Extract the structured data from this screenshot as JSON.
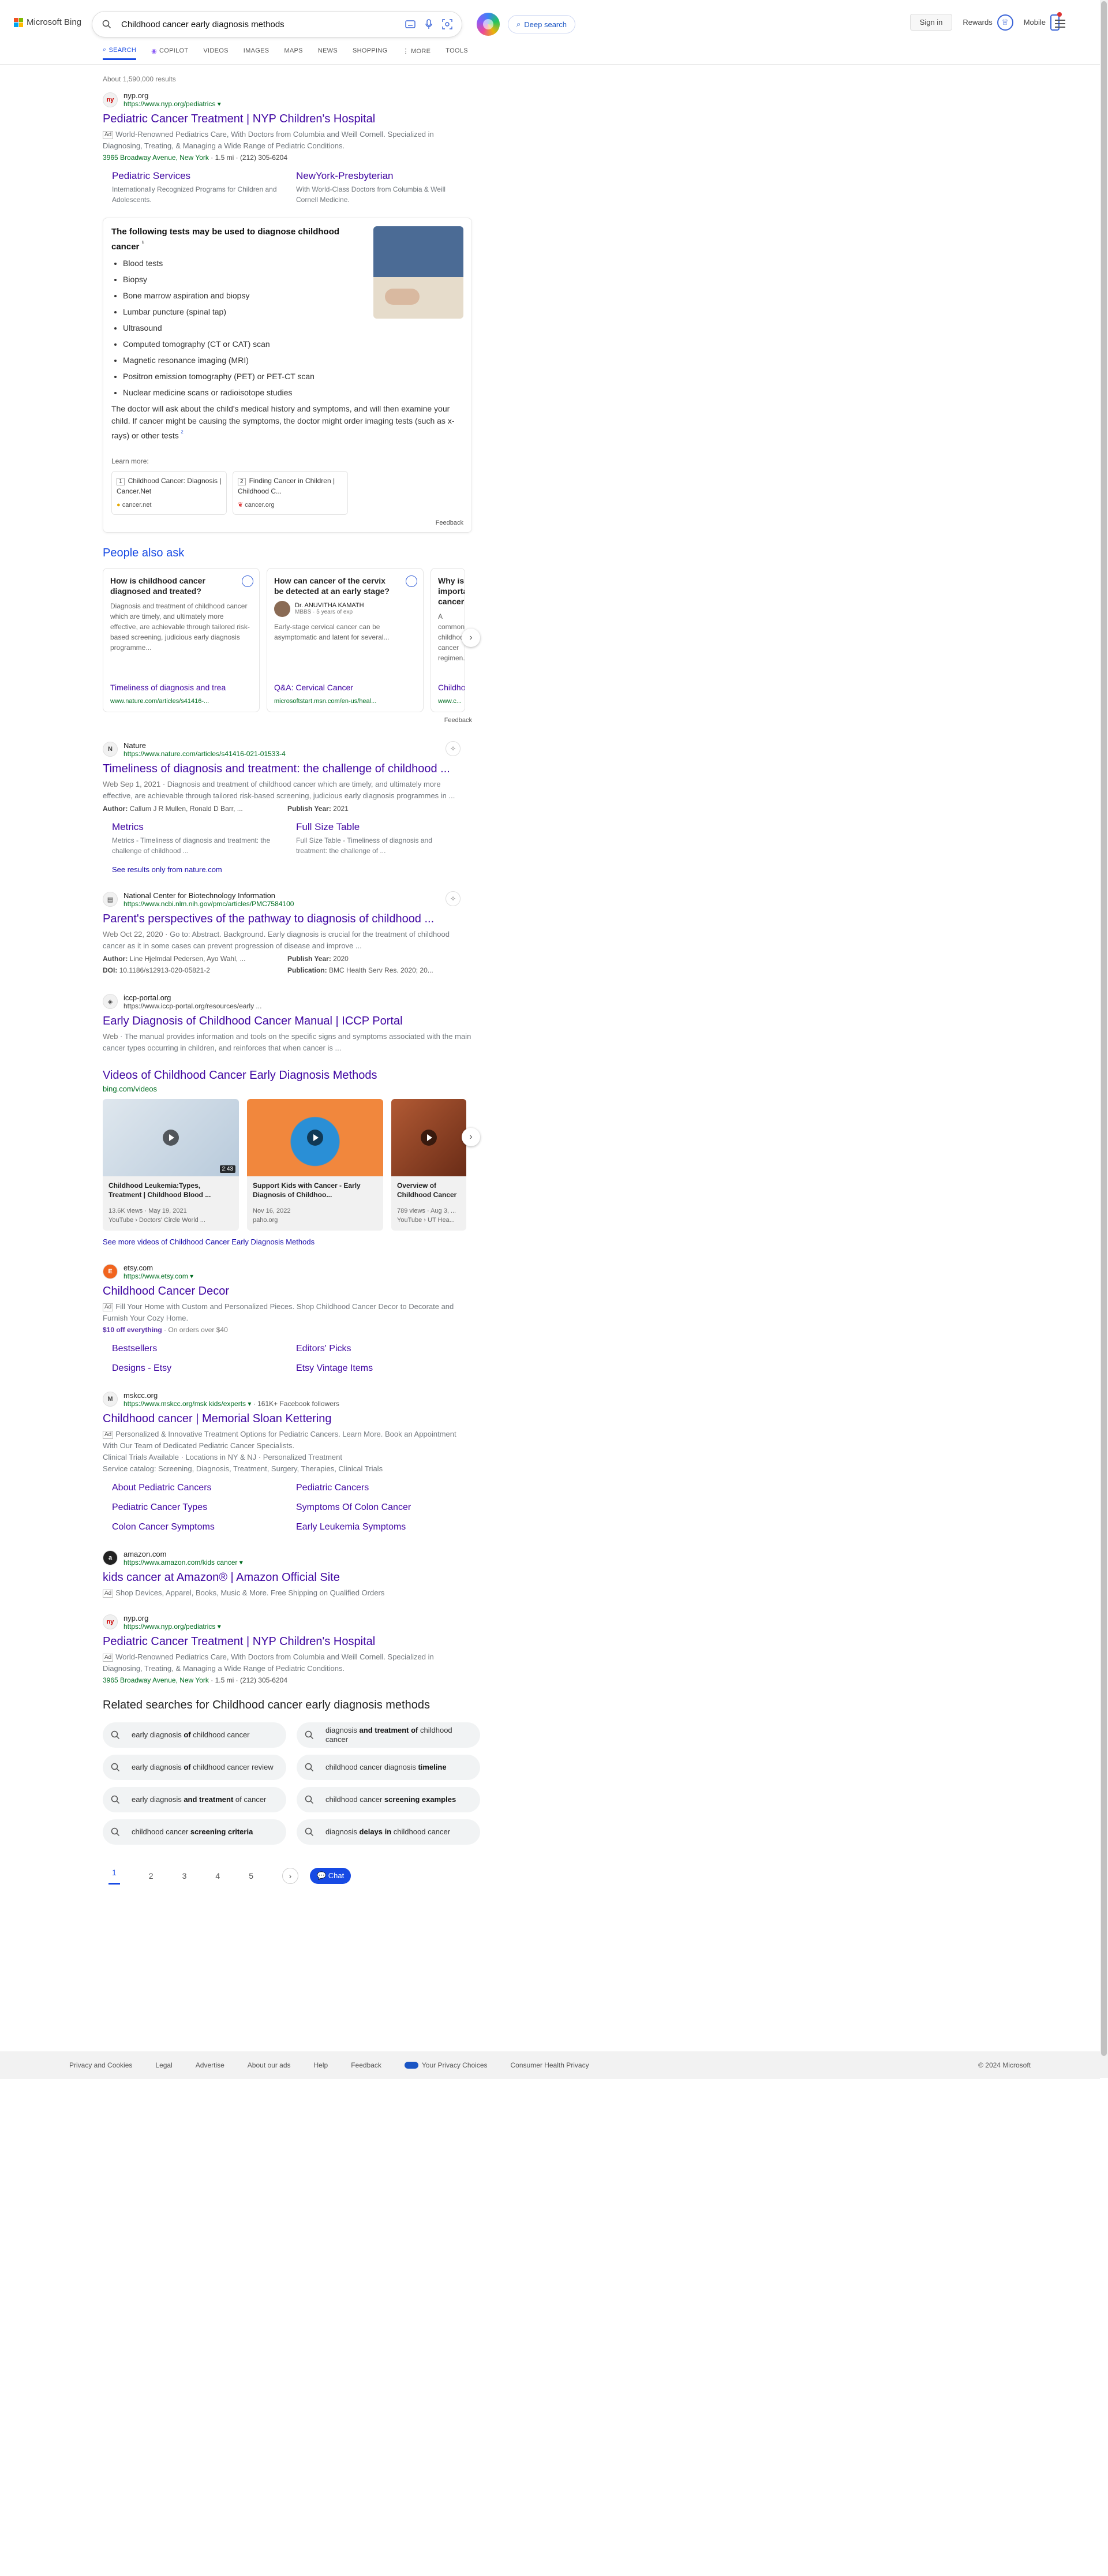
{
  "header": {
    "brand": "Microsoft Bing",
    "query": "Childhood cancer early diagnosis methods",
    "deep_search": "Deep search",
    "sign_in": "Sign in",
    "rewards": "Rewards",
    "mobile": "Mobile"
  },
  "tabs": [
    "SEARCH",
    "COPILOT",
    "VIDEOS",
    "IMAGES",
    "MAPS",
    "NEWS",
    "SHOPPING",
    "⋮ MORE",
    "TOOLS"
  ],
  "results_count": "About 1,590,000 results",
  "ad1": {
    "site": "nyp.org",
    "url": "https://www.nyp.org/pediatrics",
    "title": "Pediatric Cancer Treatment | NYP Children's Hospital",
    "ad": "Ad",
    "desc": "World-Renowned Pediatrics Care, With Doctors from Columbia and Weill Cornell. Specialized in Diagnosing, Treating, & Managing a Wide Range of Pediatric Conditions.",
    "address": "3965 Broadway Avenue, New York",
    "distance": "· 1.5 mi · (212) 305-6204",
    "sitelinks": [
      {
        "title": "Pediatric Services",
        "desc": "Internationally Recognized Programs for Children and Adolescents."
      },
      {
        "title": "NewYork-Presbyterian",
        "desc": "With World-Class Doctors from Columbia & Weill Cornell Medicine."
      }
    ]
  },
  "answer": {
    "heading": "The following tests may be used to diagnose childhood cancer",
    "tests": [
      "Blood tests",
      "Biopsy",
      "Bone marrow aspiration and biopsy",
      "Lumbar puncture (spinal tap)",
      "Ultrasound",
      "Computed tomography (CT or CAT) scan",
      "Magnetic resonance imaging (MRI)",
      "Positron emission tomography (PET) or PET-CT scan",
      "Nuclear medicine scans or radioisotope studies"
    ],
    "paragraph": "The doctor will ask about the child's medical history and symptoms, and will then examine your child. If cancer might be causing the symptoms, the doctor might order imaging tests (such as x-rays) or other tests",
    "learn_more": "Learn more:",
    "cards": [
      {
        "num": "1",
        "title": "Childhood Cancer: Diagnosis | Cancer.Net",
        "src": "cancer.net"
      },
      {
        "num": "2",
        "title": "Finding Cancer in Children | Childhood C...",
        "src": "cancer.org"
      }
    ],
    "feedback": "Feedback"
  },
  "paa": {
    "heading": "People also ask",
    "cards": [
      {
        "q": "How is childhood cancer diagnosed and treated?",
        "a": "Diagnosis and treatment of childhood cancer which are timely, and ultimately more effective, are achievable through tailored risk-based screening, judicious early diagnosis programme...",
        "link": "Timeliness of diagnosis and trea",
        "src": "www.nature.com/articles/s41416-..."
      },
      {
        "q": "How can cancer of the cervix be detected at an early stage?",
        "author": "Dr. ANUVITHA KAMATH",
        "author_sub": "MBBS · 5 years of exp",
        "a": "Early-stage cervical cancer can be asymptomatic and latent for several...",
        "link": "Q&A: Cervical Cancer",
        "src": "microsoftstart.msn.com/en-us/heal..."
      },
      {
        "q": "Why is early diagnosis important in children with cancer?",
        "a": "A common childhood cancer regimen...",
        "link": "Childhood",
        "src": "www.c..."
      }
    ],
    "feedback": "Feedback"
  },
  "r1": {
    "site": "Nature",
    "url": "https://www.nature.com/articles/s41416-021-01533-4",
    "title": "Timeliness of diagnosis and treatment: the challenge of childhood ...",
    "date": "Web Sep 1, 2021",
    "desc": "Diagnosis and treatment of childhood cancer which are timely, and ultimately more effective, are achievable through tailored risk-based screening, judicious early diagnosis programmes in ...",
    "author_label": "Author:",
    "author": "Callum J R Mullen, Ronald D Barr, ...",
    "year_label": "Publish Year:",
    "year": "2021",
    "sitelinks": [
      {
        "title": "Metrics",
        "desc": "Metrics - Timeliness of diagnosis and treatment: the challenge of childhood ..."
      },
      {
        "title": "Full Size Table",
        "desc": "Full Size Table - Timeliness of diagnosis and treatment: the challenge of ..."
      }
    ],
    "more": "See results only from nature.com"
  },
  "r2": {
    "site": "National Center for Biotechnology Information",
    "url": "https://www.ncbi.nlm.nih.gov/pmc/articles/PMC7584100",
    "title": "Parent's perspectives of the pathway to diagnosis of childhood ...",
    "date": "Web Oct 22, 2020",
    "desc": "· Go to: Abstract. Background. Early diagnosis is crucial for the treatment of childhood cancer as it in some cases can prevent progression of disease and improve ...",
    "author_label": "Author:",
    "author": "Line Hjelmdal Pedersen, Ayo Wahl, ...",
    "year_label": "Publish Year:",
    "year": "2020",
    "doi_label": "DOI:",
    "doi": "10.1186/s12913-020-05821-2",
    "pub_label": "Publication:",
    "pub": "BMC Health Serv Res. 2020; 20..."
  },
  "r3": {
    "site": "iccp-portal.org",
    "url": "https://www.iccp-portal.org/resources/early ...",
    "title": "Early Diagnosis of Childhood Cancer Manual | ICCP Portal",
    "date": "Web",
    "desc": "The manual provides information and tools on the specific signs and symptoms associated with the main cancer types occurring in children, and reinforces that when cancer is ..."
  },
  "videos": {
    "heading": "Videos of Childhood Cancer Early Diagnosis Methods",
    "source": "bing.com/videos",
    "items": [
      {
        "title": "Childhood Leukemia:Types, Treatment | Childhood Blood ...",
        "duration": "2:43",
        "views": "13.6K views · May 19, 2021",
        "channel": "YouTube › Doctors' Circle World ...",
        "bg": "#cfdbe6"
      },
      {
        "title": "Support Kids with Cancer - Early Diagnosis of Childhoo...",
        "duration": "",
        "views": "Nov 16, 2022",
        "channel": "paho.org",
        "bg": "#f1873d"
      },
      {
        "title": "Overview of Childhood Cancer",
        "duration": "",
        "views": "789 views · Aug 3, ...",
        "channel": "YouTube › UT Hea...",
        "bg": "#9a4a2b"
      }
    ],
    "more": "See more videos of Childhood Cancer Early Diagnosis Methods"
  },
  "ad2": {
    "site": "etsy.com",
    "url": "https://www.etsy.com",
    "title": "Childhood Cancer Decor",
    "ad": "Ad",
    "desc": "Fill Your Home with Custom and Personalized Pieces. Shop Childhood Cancer Decor to Decorate and Furnish Your Cozy Home.",
    "promo": "$10 off everything",
    "promo_note": "· On orders over $40",
    "links": [
      "Bestsellers",
      "Editors' Picks",
      "Designs - Etsy",
      "Etsy Vintage Items"
    ]
  },
  "ad3": {
    "site": "mskcc.org",
    "url": "https://www.mskcc.org/msk kids/experts",
    "followers": "· 161K+ Facebook followers",
    "title": "Childhood cancer | Memorial Sloan Kettering",
    "ad": "Ad",
    "desc": "Personalized & Innovative Treatment Options for Pediatric Cancers. Learn More. Book an Appointment With Our Team of Dedicated Pediatric Cancer Specialists.",
    "line2": "Clinical Trials Available · Locations in NY & NJ · Personalized Treatment",
    "line3": "Service catalog: Screening, Diagnosis, Treatment, Surgery, Therapies, Clinical Trials",
    "links": [
      "About Pediatric Cancers",
      "Pediatric Cancers",
      "Pediatric Cancer Types",
      "Symptoms Of Colon Cancer",
      "Colon Cancer Symptoms",
      "Early Leukemia Symptoms"
    ]
  },
  "ad4": {
    "site": "amazon.com",
    "url": "https://www.amazon.com/kids cancer",
    "title": "kids cancer at Amazon® | Amazon Official Site",
    "ad": "Ad",
    "desc": "Shop Devices, Apparel, Books, Music & More. Free Shipping on Qualified Orders"
  },
  "ad5": {
    "site": "nyp.org",
    "url": "https://www.nyp.org/pediatrics",
    "title": "Pediatric Cancer Treatment | NYP Children's Hospital",
    "ad": "Ad",
    "desc": "World-Renowned Pediatrics Care, With Doctors from Columbia and Weill Cornell. Specialized in Diagnosing, Treating, & Managing a Wide Range of Pediatric Conditions.",
    "address": "3965 Broadway Avenue, New York",
    "distance": "· 1.5 mi · (212) 305-6204"
  },
  "related": {
    "heading": "Related searches for Childhood cancer early diagnosis methods",
    "items": [
      {
        "pre": "early diagnosis ",
        "bold": "of",
        "post": " childhood cancer"
      },
      {
        "pre": "diagnosis ",
        "bold": "and treatment of",
        "post": " childhood cancer"
      },
      {
        "pre": "early diagnosis ",
        "bold": "of",
        "post": " childhood cancer review"
      },
      {
        "pre": "childhood cancer diagnosis ",
        "bold": "timeline",
        "post": ""
      },
      {
        "pre": "early diagnosis ",
        "bold": "and treatment",
        "post": " of cancer"
      },
      {
        "pre": "childhood cancer ",
        "bold": "screening examples",
        "post": ""
      },
      {
        "pre": "childhood cancer ",
        "bold": "screening criteria",
        "post": ""
      },
      {
        "pre": "diagnosis ",
        "bold": "delays in",
        "post": " childhood cancer"
      }
    ]
  },
  "pager": {
    "pages": [
      "1",
      "2",
      "3",
      "4",
      "5"
    ],
    "chat": "Chat"
  },
  "footer": {
    "links": [
      "Privacy and Cookies",
      "Legal",
      "Advertise",
      "About our ads",
      "Help",
      "Feedback",
      "Your Privacy Choices",
      "Consumer Health Privacy"
    ],
    "copyright": "© 2024 Microsoft"
  },
  "colors": {
    "link": "#4007a2",
    "url": "#006d21",
    "accent": "#174ae4"
  }
}
